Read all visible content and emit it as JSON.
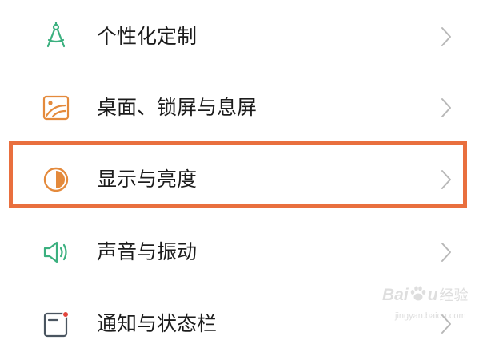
{
  "settings": {
    "items": [
      {
        "label": "个性化定制",
        "icon": "drafting-compass-icon"
      },
      {
        "label": "桌面、锁屏与息屏",
        "icon": "wallpaper-icon"
      },
      {
        "label": "显示与亮度",
        "icon": "brightness-half-circle-icon"
      },
      {
        "label": "声音与振动",
        "icon": "speaker-icon"
      },
      {
        "label": "通知与状态栏",
        "icon": "notification-badge-icon"
      }
    ],
    "highlighted_index": 2,
    "chevron_icon": "chevron-right-icon"
  },
  "colors": {
    "highlight_border": "#e96f3e",
    "label_text": "#1c1c1c",
    "chevron": "#b8b8b8",
    "icon_green": "#3bb07f",
    "icon_orange": "#e48a3c",
    "icon_gray": "#4a5560",
    "icon_red_dot": "#e2453c"
  },
  "watermark": {
    "brand": "Bai",
    "brand_suffix": "u",
    "jingyan": "经验",
    "url": "jingyan.baidu.com"
  }
}
